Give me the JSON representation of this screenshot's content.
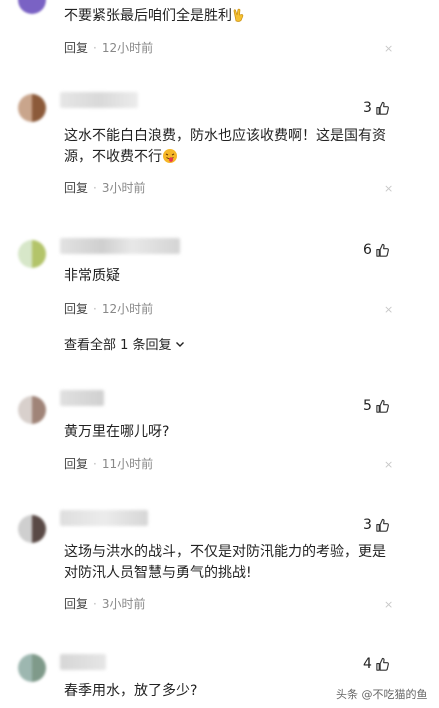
{
  "comments": [
    {
      "text": "不要紧张最后咱们全是胜利",
      "reply_label": "回复",
      "time": "12小时前",
      "close": "×"
    },
    {
      "likes": "3",
      "text_line1": "这水不能白白浪费，防水也应该收费啊！这是国有资",
      "text_line2": "源，不收费不行",
      "reply_label": "回复",
      "time": "3小时前",
      "close": "×"
    },
    {
      "likes": "6",
      "text": "非常质疑",
      "reply_label": "回复",
      "time": "12小时前",
      "close": "×",
      "view_all": "查看全部 1 条回复"
    },
    {
      "likes": "5",
      "text": "黄万里在哪儿呀?",
      "reply_label": "回复",
      "time": "11小时前",
      "close": "×"
    },
    {
      "likes": "3",
      "text_line1": "这场与洪水的战斗，不仅是对防汛能力的考验，更是",
      "text_line2": "对防汛人员智慧与勇气的挑战!",
      "reply_label": "回复",
      "time": "3小时前",
      "close": "×"
    },
    {
      "likes": "4",
      "text": "春季用水，放了多少?"
    }
  ],
  "watermark": "头条 @不吃猫的鱼",
  "colors": {
    "like_icon": "#333333",
    "close_icon": "#c8c8c8",
    "emoji_face": "#f5b728",
    "emoji_tongue": "#e8384f"
  }
}
